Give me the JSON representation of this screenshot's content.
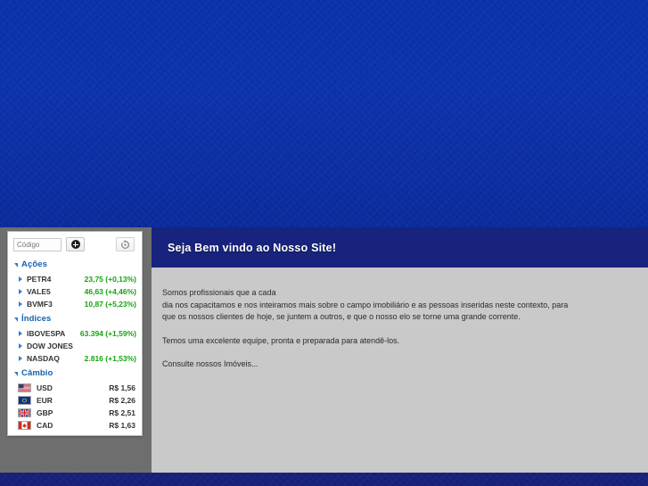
{
  "background": {
    "top_color": "#0a31ad",
    "bottom_color": "#17207a"
  },
  "ticker_widget": {
    "toolbar": {
      "code_input_placeholder": "Código",
      "code_input_value": "",
      "add_button_label": "add-quote",
      "add_icon": "plus-circle-icon",
      "refresh_button_label": "refresh-quotes",
      "refresh_icon": "refresh-icon"
    },
    "groups": [
      {
        "title": "Ações",
        "expanded": true,
        "rows": [
          {
            "label": "PETR4",
            "value": "23,75 (+0,13%)",
            "positive": true
          },
          {
            "label": "VALE5",
            "value": "46,63 (+4,46%)",
            "positive": true
          },
          {
            "label": "BVMF3",
            "value": "10,87 (+5,23%)",
            "positive": true
          }
        ]
      },
      {
        "title": "Índices",
        "expanded": true,
        "rows": [
          {
            "label": "IBOVESPA",
            "value": "63.394 (+1,59%)",
            "positive": true
          },
          {
            "label": "DOW JONES",
            "value": "",
            "positive": false
          },
          {
            "label": "NASDAQ",
            "value": "2.816 (+1,53%)",
            "positive": true
          }
        ]
      }
    ],
    "currency_group": {
      "title": "Câmbio",
      "expanded": true,
      "rows": [
        {
          "code": "USD",
          "value": "R$ 1,56",
          "flag": "flag-usa-icon"
        },
        {
          "code": "EUR",
          "value": "R$ 2,26",
          "flag": "flag-eu-icon"
        },
        {
          "code": "GBP",
          "value": "R$ 2,51",
          "flag": "flag-uk-icon"
        },
        {
          "code": "CAD",
          "value": "R$ 1,63",
          "flag": "flag-canada-icon"
        }
      ]
    },
    "colors": {
      "positive": "#16a310",
      "group_title": "#1761b0",
      "triangle": "#2f7fd4"
    }
  },
  "content": {
    "header_title": "Seja Bem vindo ao Nosso Site!",
    "header_bg": "#17237c",
    "paragraphs": [
      "Somos profissionais que a cada\ndia nos capacitamos e nos inteiramos mais sobre o campo imobiliário e as pessoas inseridas neste contexto, para que os nossos clientes de hoje, se juntem a outros, e que o nosso elo se torne uma grande corrente.",
      "Temos uma excelente equipe, pronta e preparada para atendê-los.",
      "Consulte nossos Imóveis..."
    ]
  }
}
